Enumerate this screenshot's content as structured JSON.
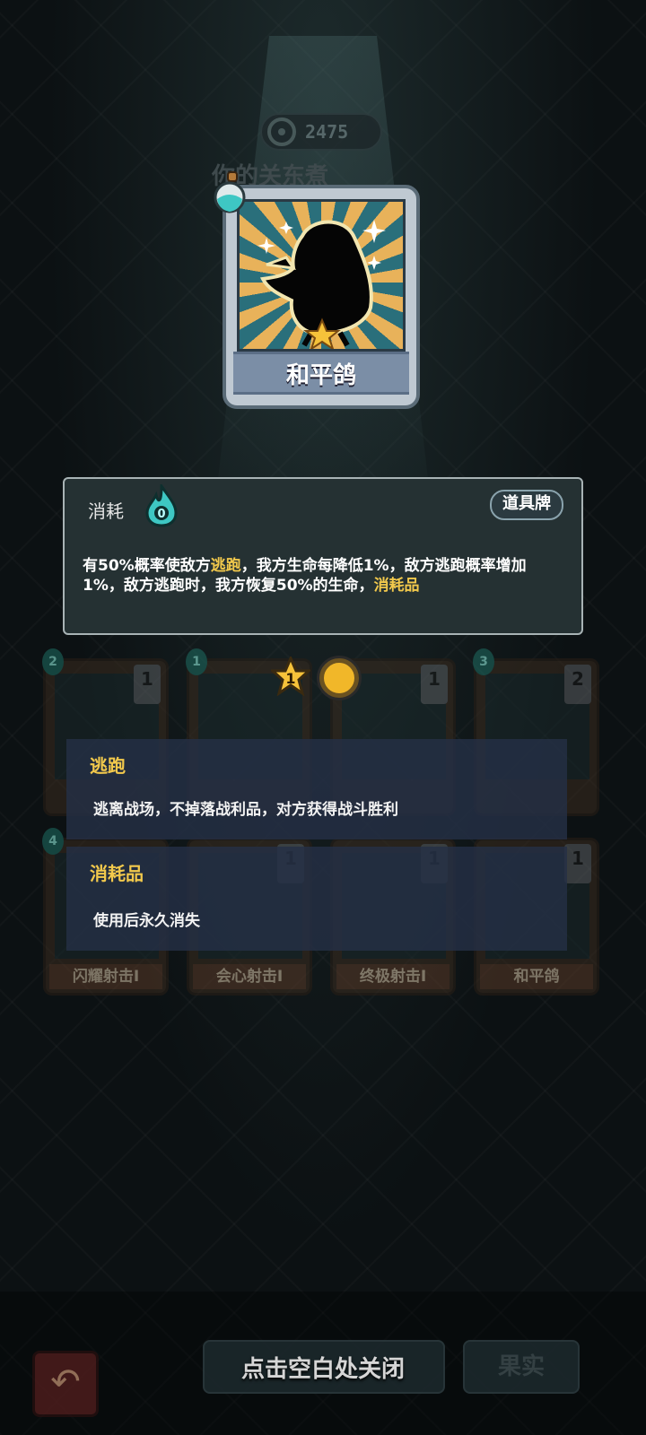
{
  "header": {
    "score": "2475",
    "subtitle": "你的关东煮"
  },
  "card": {
    "name": "和平鸽",
    "cost_label": "消耗",
    "cost_value": "0",
    "type_badge": "道具牌",
    "description_parts": [
      "有50%概率使敌方",
      "逃跑",
      "，我方生命每降低1%，敌方逃跑概率增加1%，敌方逃跑时，我方恢复50%的生命，",
      "消耗品"
    ]
  },
  "chips": {
    "star_level": "1"
  },
  "deck": {
    "cards": [
      {
        "cost": "2",
        "level": "1",
        "label": ""
      },
      {
        "cost": "1",
        "level": "",
        "label": ""
      },
      {
        "cost": "",
        "level": "1",
        "label": ""
      },
      {
        "cost": "3",
        "level": "2",
        "label": ""
      },
      {
        "cost": "4",
        "level": "",
        "label": "闪耀射击I"
      },
      {
        "cost": "",
        "level": "1",
        "label": "会心射击I"
      },
      {
        "cost": "",
        "level": "1",
        "label": "终极射击I"
      },
      {
        "cost": "",
        "level": "1",
        "label": "和平鸽"
      }
    ]
  },
  "keywords": [
    {
      "title": "逃跑",
      "text": "逃离战场，不掉落战利品，对方获得战斗胜利"
    },
    {
      "title": "消耗品",
      "text": "使用后永久消失"
    }
  ],
  "bottom": {
    "hint": "点击空白处关闭",
    "ghost_button_1": "",
    "ghost_button_2": "果实",
    "back_icon": "↶"
  },
  "colors": {
    "highlight": "#f2c94c",
    "panel_bg": "#253133",
    "tooltip_bg": "#243046"
  }
}
